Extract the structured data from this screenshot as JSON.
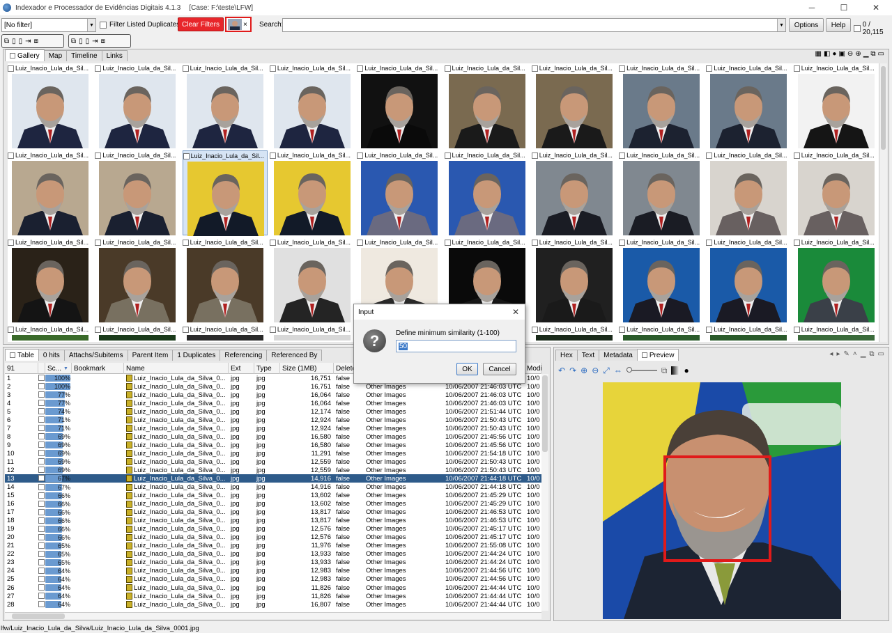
{
  "window": {
    "title": "Indexador e Processador de Evidências Digitais 4.1.3",
    "case": "[Case: F:\\teste\\LFW]",
    "minimize": "─",
    "maximize": "☐",
    "close": "✕"
  },
  "toolbar": {
    "filter_value": "[No filter]",
    "filter_dup_label": "Filter Listed Duplicates",
    "clear_filters": "Clear Filters",
    "search_label": "Search:",
    "search_value": "",
    "options": "Options",
    "help": "Help",
    "counter": "0 / 20,115",
    "face_filter_close": "×"
  },
  "gallery": {
    "tabs": [
      "Gallery",
      "Map",
      "Timeline",
      "Links"
    ],
    "caption": "Luiz_Inacio_Lula_da_Sil..."
  },
  "table": {
    "tabs": [
      "Table",
      "0 hits",
      "Attachs/Subitems",
      "Parent Item",
      "1 Duplicates",
      "Referencing",
      "Referenced By"
    ],
    "headers": {
      "count": "91",
      "score": "Sc...",
      "bookmark": "Bookmark",
      "name": "Name",
      "ext": "Ext",
      "type": "Type",
      "size": "Size (1MB)",
      "deleted": "Delete",
      "category": "",
      "created": "",
      "modified": "Modi"
    },
    "name_value": "Luiz_Inacio_Lula_da_Silva_0...",
    "ext_value": "jpg",
    "type_value": "jpg",
    "deleted_value": "false",
    "category_value": "Other Images",
    "modified_value": "10/0",
    "rows": [
      {
        "n": "1",
        "score": "100%",
        "size": "16,751",
        "date": "10/06/2007 21:46:03 UTC"
      },
      {
        "n": "2",
        "score": "100%",
        "size": "16,751",
        "date": "10/06/2007 21:46:03 UTC"
      },
      {
        "n": "3",
        "score": "77%",
        "size": "16,064",
        "date": "10/06/2007 21:46:03 UTC"
      },
      {
        "n": "4",
        "score": "77%",
        "size": "16,064",
        "date": "10/06/2007 21:46:03 UTC"
      },
      {
        "n": "5",
        "score": "74%",
        "size": "12,174",
        "date": "10/06/2007 21:51:44 UTC"
      },
      {
        "n": "6",
        "score": "71%",
        "size": "12,924",
        "date": "10/06/2007 21:50:43 UTC"
      },
      {
        "n": "7",
        "score": "71%",
        "size": "12,924",
        "date": "10/06/2007 21:50:43 UTC"
      },
      {
        "n": "8",
        "score": "69%",
        "size": "16,580",
        "date": "10/06/2007 21:45:56 UTC"
      },
      {
        "n": "9",
        "score": "69%",
        "size": "16,580",
        "date": "10/06/2007 21:45:56 UTC"
      },
      {
        "n": "10",
        "score": "69%",
        "size": "11,291",
        "date": "10/06/2007 21:54:18 UTC"
      },
      {
        "n": "11",
        "score": "69%",
        "size": "12,559",
        "date": "10/06/2007 21:50:43 UTC"
      },
      {
        "n": "12",
        "score": "69%",
        "size": "12,559",
        "date": "10/06/2007 21:50:43 UTC"
      },
      {
        "n": "13",
        "score": "67%",
        "size": "14,916",
        "date": "10/06/2007 21:44:18 UTC"
      },
      {
        "n": "14",
        "score": "67%",
        "size": "14,916",
        "date": "10/06/2007 21:44:18 UTC"
      },
      {
        "n": "15",
        "score": "66%",
        "size": "13,602",
        "date": "10/06/2007 21:45:29 UTC"
      },
      {
        "n": "16",
        "score": "66%",
        "size": "13,602",
        "date": "10/06/2007 21:45:29 UTC"
      },
      {
        "n": "17",
        "score": "66%",
        "size": "13,817",
        "date": "10/06/2007 21:46:53 UTC"
      },
      {
        "n": "18",
        "score": "66%",
        "size": "13,817",
        "date": "10/06/2007 21:46:53 UTC"
      },
      {
        "n": "19",
        "score": "66%",
        "size": "12,576",
        "date": "10/06/2007 21:45:17 UTC"
      },
      {
        "n": "20",
        "score": "66%",
        "size": "12,576",
        "date": "10/06/2007 21:45:17 UTC"
      },
      {
        "n": "21",
        "score": "65%",
        "size": "11,976",
        "date": "10/06/2007 21:55:08 UTC"
      },
      {
        "n": "22",
        "score": "65%",
        "size": "13,933",
        "date": "10/06/2007 21:44:24 UTC"
      },
      {
        "n": "23",
        "score": "65%",
        "size": "13,933",
        "date": "10/06/2007 21:44:24 UTC"
      },
      {
        "n": "24",
        "score": "64%",
        "size": "12,983",
        "date": "10/06/2007 21:44:56 UTC"
      },
      {
        "n": "25",
        "score": "64%",
        "size": "12,983",
        "date": "10/06/2007 21:44:56 UTC"
      },
      {
        "n": "26",
        "score": "64%",
        "size": "11,826",
        "date": "10/06/2007 21:44:44 UTC"
      },
      {
        "n": "27",
        "score": "64%",
        "size": "11,826",
        "date": "10/06/2007 21:44:44 UTC"
      },
      {
        "n": "28",
        "score": "64%",
        "size": "16,807",
        "date": "10/06/2007 21:44:44 UTC"
      }
    ]
  },
  "viewer": {
    "tabs": [
      "Hex",
      "Text",
      "Metadata",
      "Preview"
    ]
  },
  "dialog": {
    "title": "Input",
    "label": "Define minimum similarity (1-100)",
    "value": "50",
    "ok": "OK",
    "cancel": "Cancel",
    "close": "✕"
  },
  "status": {
    "path": "lfw/Luiz_Inacio_Lula_da_Silva/Luiz_Inacio_Lula_da_Silva_0001.jpg"
  },
  "colors": {
    "clear_filters_bg": "#e8262b",
    "selection": "#2e5b8a",
    "score_bar": "#6a9ad0",
    "face_box": "#e01a1a"
  }
}
